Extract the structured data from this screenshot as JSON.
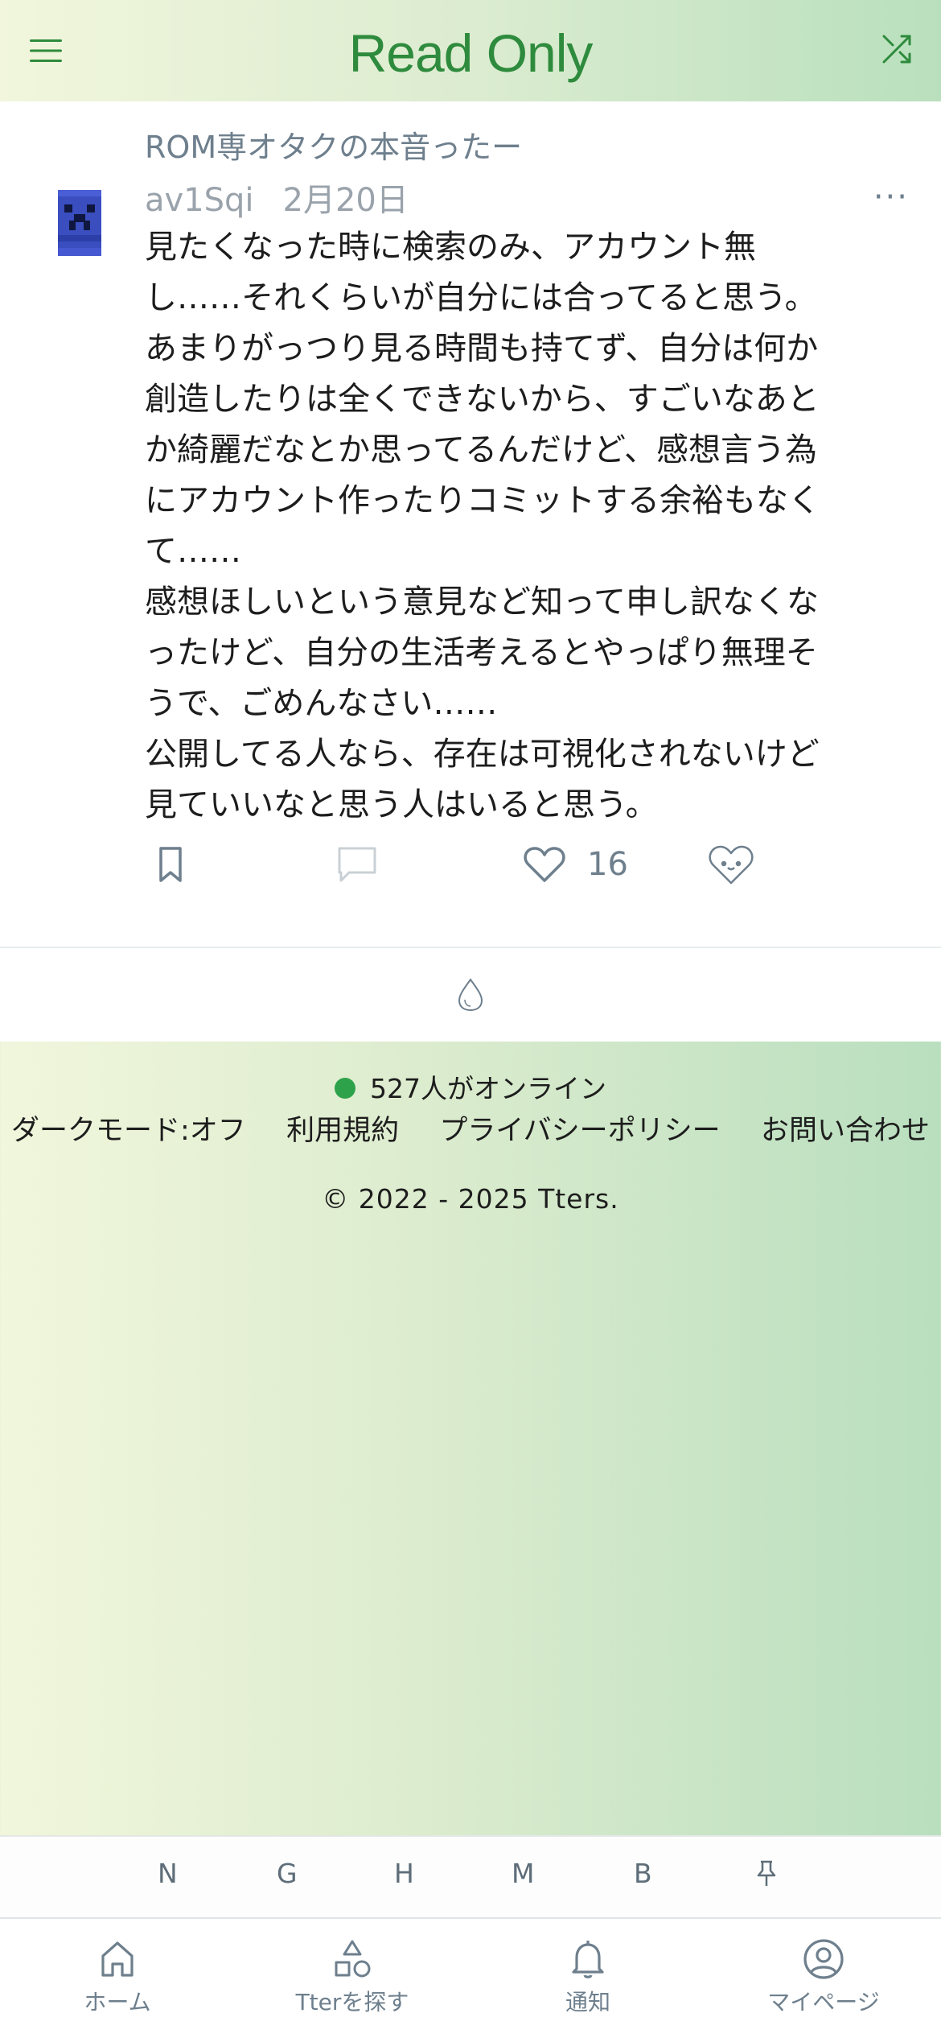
{
  "header": {
    "title": "Read Only"
  },
  "post": {
    "group": "ROM専オタクの本音ったー",
    "user_id": "av1Sqi",
    "date": "2月20日",
    "more": "···",
    "body_lines": [
      "見たくなった時に検索のみ、アカウント無\nし……それくらいが自分には合ってると思う。\nあまりがっつり見る時間も持てず、自分は何か\n創造したりは全くできないから、すごいなあと\nか綺麗だなとか思ってるんだけど、感想言う為\nにアカウント作ったりコミットする余裕もなく\nて……\n感想ほしいという意見など知って申し訳なくな\nったけど、自分の生活考えるとやっぱり無理そ\nうで、ごめんなさい……\n公開してる人なら、存在は可視化されないけど\n見ていいなと思う人はいると思う。"
    ],
    "like_count": "16"
  },
  "footer": {
    "online_text": "527人がオンライン",
    "links": [
      "ダークモード:オフ",
      "利用規約",
      "プライバシーポリシー",
      "お問い合わせ"
    ],
    "copyright": "© 2022 - 2025 Tters."
  },
  "letter_bar": [
    "N",
    "G",
    "H",
    "M",
    "B"
  ],
  "bottom_nav": [
    {
      "label": "ホーム",
      "icon": "home-icon"
    },
    {
      "label": "Tterを探す",
      "icon": "shapes-icon"
    },
    {
      "label": "通知",
      "icon": "bell-icon"
    },
    {
      "label": "マイページ",
      "icon": "user-circle-icon"
    }
  ],
  "colors": {
    "accent": "#2e8b3d",
    "online": "#2ea24a",
    "muted": "#6e7f8d"
  }
}
